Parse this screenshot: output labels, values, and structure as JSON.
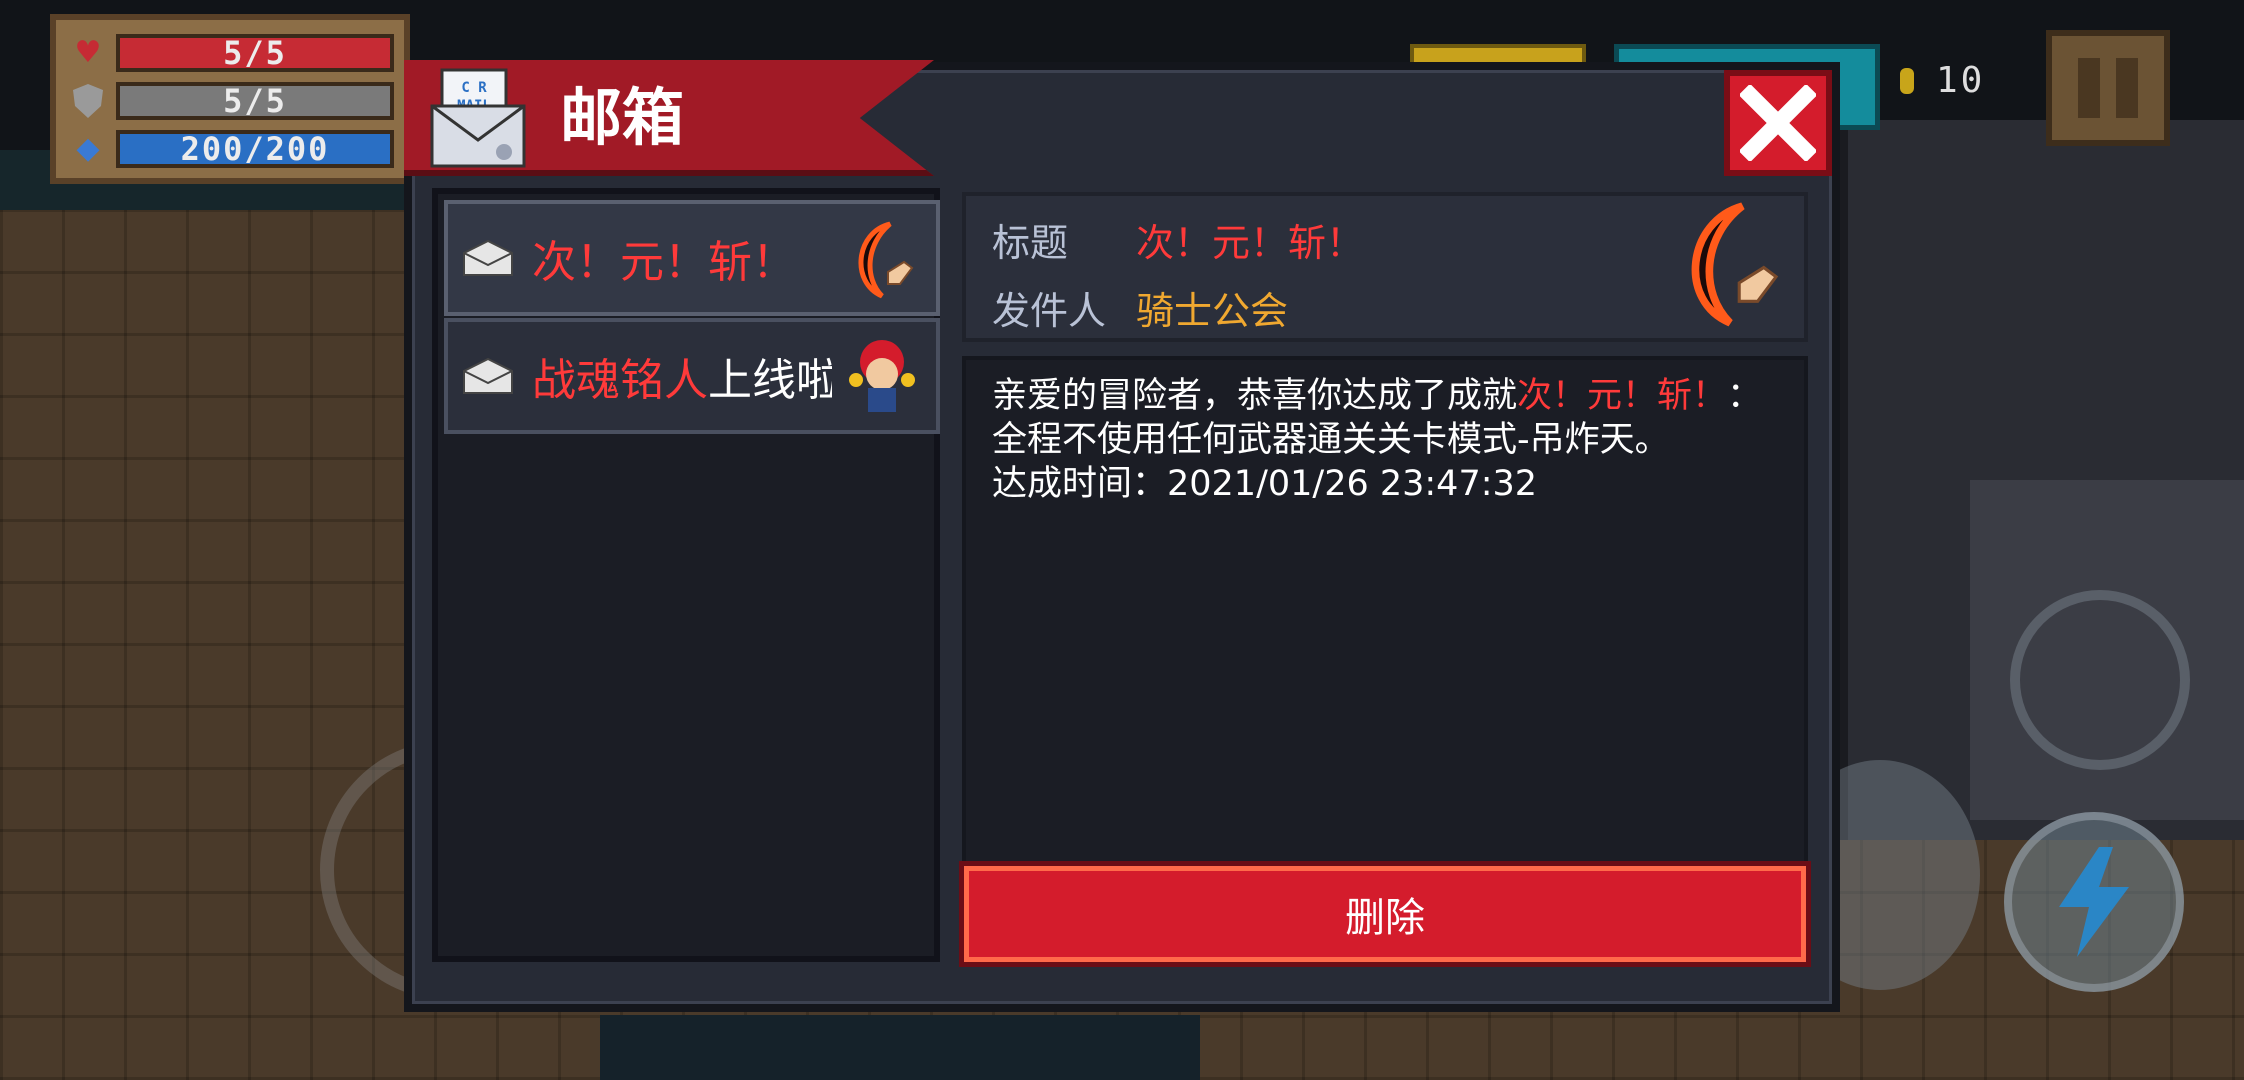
{
  "hud": {
    "hp": "5/5",
    "hp_level": 1.0,
    "armor": "5/5",
    "armor_level": 1.0,
    "energy": "200/200",
    "energy_level": 1.0,
    "colors": {
      "hp": "#c62b34",
      "armor": "#7a7a7a",
      "energy": "#2a6fc4"
    }
  },
  "coins": "10",
  "dialog": {
    "title": "邮箱",
    "mail_list": [
      {
        "title_red": "次！元！斩！",
        "title_white": "",
        "thumb": "crescent-blade-icon"
      },
      {
        "title_red": "战魂铭人",
        "title_white": "上线啦",
        "thumb": "red-hat-hero-icon"
      }
    ],
    "detail": {
      "subject_label": "标题",
      "subject": "次！元！斩！",
      "sender_label": "发件人",
      "sender": "骑士公会",
      "body_line1_a": "亲爱的冒险者，恭喜你达成了成就",
      "body_line1_b": "次！元！斩！",
      "body_line1_c": "：",
      "body_line2": "全程不使用任何武器通关关卡模式-吊炸天。",
      "body_line3": "达成时间：2021/01/26 23:47:32"
    },
    "delete_label": "删除"
  },
  "colors": {
    "accent_red": "#d41c2c",
    "subject_red": "#ff3a3a",
    "sender_orange": "#f0a830",
    "label_gray": "#b9c2d6"
  }
}
